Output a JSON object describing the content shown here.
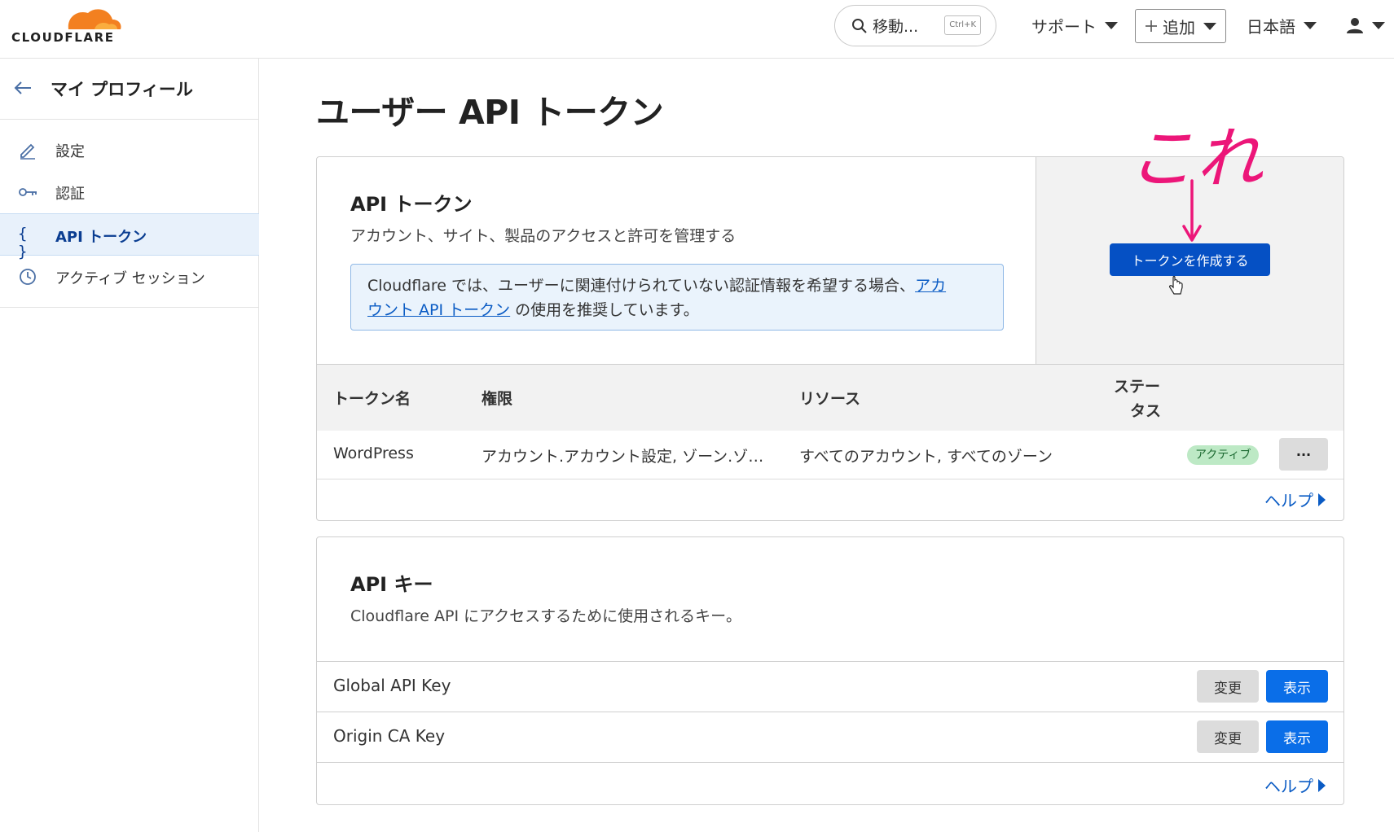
{
  "header": {
    "logo_text": "CLOUDFLARE",
    "search_label": "移動...",
    "search_shortcut": "Ctrl+K",
    "support_label": "サポート",
    "add_label": "追加",
    "language_label": "日本語",
    "user_icon": "user-icon"
  },
  "sidebar": {
    "title": "マイ プロフィール",
    "items": [
      {
        "label": "設定",
        "icon": "pencil-icon"
      },
      {
        "label": "認証",
        "icon": "key-icon"
      },
      {
        "label": "API トークン",
        "icon": "braces-icon",
        "active": true
      },
      {
        "label": "アクティブ セッション",
        "icon": "clock-icon"
      }
    ]
  },
  "main": {
    "page_title": "ユーザー API トークン",
    "tokens_card": {
      "title": "API トークン",
      "description": "アカウント、サイト、製品のアクセスと許可を管理する",
      "notice_prefix": "Cloudflare では、ユーザーに関連付けられていない認証情報を希望する場合、",
      "notice_link_1": "アカ",
      "notice_link_2": "ウント API トークン",
      "notice_suffix": " の使用を推奨しています。",
      "create_button": "トークンを作成する",
      "table": {
        "headers": [
          "トークン名",
          "権限",
          "リソース",
          "ステー",
          "タス"
        ],
        "rows": [
          {
            "name": "WordPress",
            "permissions": "アカウント.アカウント設定, ゾーン.ゾ…",
            "resources": "すべてのアカウント, すべてのゾーン",
            "status": "アクティブ",
            "more": "···"
          }
        ]
      },
      "help_label": "ヘルプ"
    },
    "keys_card": {
      "title": "API キー",
      "description": "Cloudflare API にアクセスするために使用されるキー。",
      "rows": [
        {
          "name": "Global API Key",
          "change": "変更",
          "view": "表示"
        },
        {
          "name": "Origin CA Key",
          "change": "変更",
          "view": "表示"
        }
      ],
      "help_label": "ヘルプ"
    },
    "annotation": "これ"
  },
  "colors": {
    "brand_orange": "#f38020",
    "primary_blue": "#0550c4",
    "annotation_pink": "#ec1679",
    "status_green": "#bde9c5"
  }
}
